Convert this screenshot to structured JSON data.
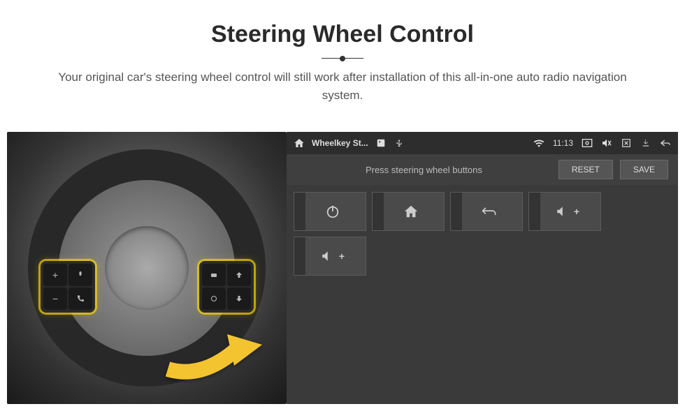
{
  "header": {
    "title": "Steering Wheel Control",
    "subtitle": "Your original car's steering wheel control will still work after installation of this all-in-one auto radio navigation system."
  },
  "wheel": {
    "left_buttons": [
      "+",
      "voice",
      "−",
      "phone"
    ],
    "right_buttons": [
      "mode",
      "up",
      "cycle",
      "down"
    ]
  },
  "statusbar": {
    "app_title": "Wheelkey St...",
    "time": "11:13",
    "icons": {
      "home": "home-icon",
      "image": "image-icon",
      "usb": "usb-icon",
      "wifi": "wifi-icon",
      "screenshot": "screenshot-icon",
      "mute": "mute-icon",
      "close": "close-box-icon",
      "download": "download-icon",
      "back": "back-icon"
    }
  },
  "toolbar": {
    "instruction": "Press steering wheel buttons",
    "reset_label": "RESET",
    "save_label": "SAVE"
  },
  "actions": [
    {
      "name": "power",
      "label": ""
    },
    {
      "name": "home",
      "label": ""
    },
    {
      "name": "return",
      "label": ""
    },
    {
      "name": "volume-up-1",
      "label": "+"
    },
    {
      "name": "volume-up-2",
      "label": "+"
    }
  ]
}
